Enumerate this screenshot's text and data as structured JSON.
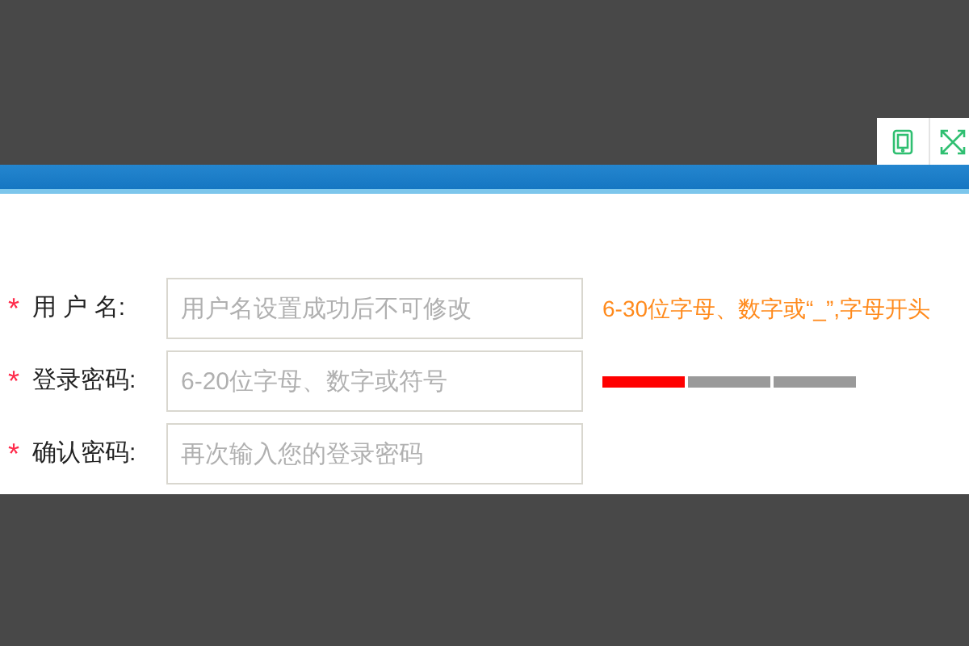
{
  "fields": [
    {
      "mark": "*",
      "label": "用 户 名:",
      "placeholder": "用户名设置成功后不可修改",
      "kind": "hint",
      "hint": "6-30位字母、数字或“_”,字母开头"
    },
    {
      "mark": "*",
      "label": "登录密码:",
      "placeholder": "6-20位字母、数字或符号",
      "kind": "strength",
      "level": 0.33
    },
    {
      "mark": "*",
      "label": "确认密码:",
      "placeholder": "再次输入您的登录密码",
      "kind": "plain"
    }
  ]
}
